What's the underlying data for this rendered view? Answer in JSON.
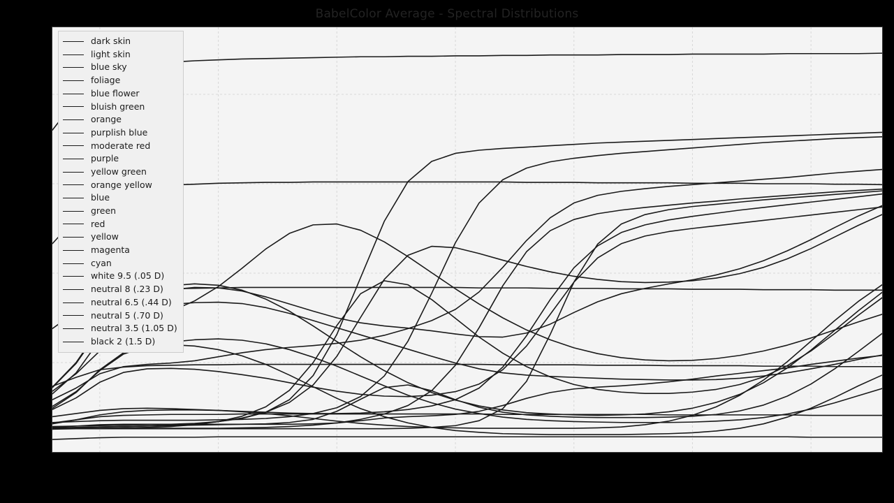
{
  "figure": {
    "background_color": "#000000",
    "plot_background_color": "#f4f4f4",
    "title": "BabelColor Average - Spectral Distributions",
    "title_color": "#232323",
    "line_color": "#1a1a1a",
    "grid_color": "#d8d8d8"
  },
  "legend": {
    "location": "upper left",
    "entries": [
      "dark skin",
      "light skin",
      "blue sky",
      "foliage",
      "blue flower",
      "bluish green",
      "orange",
      "purplish blue",
      "moderate red",
      "purple",
      "yellow green",
      "orange yellow",
      "blue",
      "green",
      "red",
      "yellow",
      "magenta",
      "cyan",
      "white 9.5 (.05 D)",
      "neutral 8 (.23 D)",
      "neutral 6.5 (.44 D)",
      "neutral 5 (.70 D)",
      "neutral 3.5 (1.05 D)",
      "black 2 (1.5 D)"
    ]
  },
  "chart_data": {
    "type": "line",
    "title": "BabelColor Average - Spectral Distributions",
    "xlabel": "",
    "ylabel": "",
    "xlim": [
      380,
      730
    ],
    "ylim": [
      0.0,
      0.95
    ],
    "grid": true,
    "legend_position": "upper left",
    "x": [
      380,
      390,
      400,
      410,
      420,
      430,
      440,
      450,
      460,
      470,
      480,
      490,
      500,
      510,
      520,
      530,
      540,
      550,
      560,
      570,
      580,
      590,
      600,
      610,
      620,
      630,
      640,
      650,
      660,
      670,
      680,
      690,
      700,
      710,
      720,
      730
    ],
    "series": [
      {
        "name": "dark skin",
        "values": [
          0.055,
          0.058,
          0.061,
          0.062,
          0.062,
          0.062,
          0.062,
          0.062,
          0.062,
          0.062,
          0.062,
          0.063,
          0.065,
          0.07,
          0.076,
          0.079,
          0.081,
          0.084,
          0.091,
          0.104,
          0.12,
          0.133,
          0.141,
          0.145,
          0.148,
          0.152,
          0.157,
          0.163,
          0.17,
          0.176,
          0.182,
          0.188,
          0.196,
          0.203,
          0.21,
          0.216
        ]
      },
      {
        "name": "light skin",
        "values": [
          0.117,
          0.143,
          0.175,
          0.191,
          0.196,
          0.199,
          0.204,
          0.213,
          0.222,
          0.229,
          0.234,
          0.238,
          0.243,
          0.25,
          0.261,
          0.276,
          0.294,
          0.319,
          0.358,
          0.413,
          0.473,
          0.524,
          0.557,
          0.574,
          0.583,
          0.589,
          0.594,
          0.598,
          0.602,
          0.606,
          0.61,
          0.614,
          0.619,
          0.624,
          0.628,
          0.632
        ]
      },
      {
        "name": "blue sky",
        "values": [
          0.13,
          0.177,
          0.251,
          0.306,
          0.324,
          0.33,
          0.334,
          0.335,
          0.332,
          0.323,
          0.31,
          0.294,
          0.278,
          0.262,
          0.246,
          0.23,
          0.214,
          0.199,
          0.186,
          0.177,
          0.172,
          0.169,
          0.167,
          0.165,
          0.163,
          0.162,
          0.161,
          0.161,
          0.162,
          0.165,
          0.17,
          0.177,
          0.186,
          0.196,
          0.207,
          0.217
        ]
      },
      {
        "name": "foliage",
        "values": [
          0.051,
          0.054,
          0.056,
          0.057,
          0.058,
          0.059,
          0.06,
          0.061,
          0.062,
          0.063,
          0.066,
          0.073,
          0.091,
          0.118,
          0.144,
          0.15,
          0.137,
          0.117,
          0.1,
          0.089,
          0.083,
          0.08,
          0.078,
          0.077,
          0.077,
          0.077,
          0.078,
          0.08,
          0.084,
          0.092,
          0.105,
          0.125,
          0.152,
          0.186,
          0.225,
          0.265
        ]
      },
      {
        "name": "blue flower",
        "values": [
          0.144,
          0.198,
          0.274,
          0.33,
          0.353,
          0.363,
          0.368,
          0.367,
          0.36,
          0.347,
          0.331,
          0.315,
          0.3,
          0.289,
          0.282,
          0.277,
          0.271,
          0.264,
          0.258,
          0.257,
          0.266,
          0.286,
          0.312,
          0.336,
          0.354,
          0.366,
          0.376,
          0.385,
          0.396,
          0.41,
          0.428,
          0.45,
          0.475,
          0.502,
          0.528,
          0.551
        ]
      },
      {
        "name": "bluish green",
        "values": [
          0.136,
          0.175,
          0.226,
          0.27,
          0.296,
          0.315,
          0.338,
          0.37,
          0.411,
          0.454,
          0.489,
          0.508,
          0.51,
          0.496,
          0.47,
          0.437,
          0.401,
          0.365,
          0.331,
          0.3,
          0.273,
          0.251,
          0.233,
          0.22,
          0.211,
          0.206,
          0.204,
          0.205,
          0.209,
          0.216,
          0.226,
          0.239,
          0.255,
          0.273,
          0.291,
          0.308
        ]
      },
      {
        "name": "orange",
        "values": [
          0.054,
          0.054,
          0.053,
          0.053,
          0.053,
          0.053,
          0.053,
          0.053,
          0.054,
          0.055,
          0.057,
          0.06,
          0.065,
          0.073,
          0.085,
          0.104,
          0.137,
          0.194,
          0.278,
          0.372,
          0.448,
          0.495,
          0.52,
          0.533,
          0.541,
          0.547,
          0.552,
          0.557,
          0.561,
          0.566,
          0.57,
          0.574,
          0.578,
          0.582,
          0.585,
          0.588
        ]
      },
      {
        "name": "purplish blue",
        "values": [
          0.145,
          0.2,
          0.277,
          0.335,
          0.361,
          0.372,
          0.376,
          0.373,
          0.362,
          0.342,
          0.315,
          0.282,
          0.247,
          0.213,
          0.182,
          0.155,
          0.133,
          0.116,
          0.103,
          0.094,
          0.088,
          0.085,
          0.083,
          0.082,
          0.083,
          0.085,
          0.09,
          0.098,
          0.111,
          0.129,
          0.155,
          0.188,
          0.228,
          0.272,
          0.316,
          0.357
        ]
      },
      {
        "name": "moderate red",
        "values": [
          0.079,
          0.086,
          0.093,
          0.097,
          0.098,
          0.097,
          0.095,
          0.093,
          0.091,
          0.089,
          0.087,
          0.086,
          0.086,
          0.087,
          0.09,
          0.095,
          0.103,
          0.117,
          0.143,
          0.19,
          0.26,
          0.341,
          0.412,
          0.461,
          0.491,
          0.508,
          0.519,
          0.527,
          0.534,
          0.541,
          0.547,
          0.553,
          0.559,
          0.565,
          0.571,
          0.577
        ]
      },
      {
        "name": "purple",
        "values": [
          0.063,
          0.072,
          0.083,
          0.09,
          0.093,
          0.094,
          0.094,
          0.093,
          0.09,
          0.086,
          0.081,
          0.075,
          0.069,
          0.064,
          0.06,
          0.057,
          0.055,
          0.054,
          0.053,
          0.053,
          0.053,
          0.053,
          0.053,
          0.054,
          0.056,
          0.061,
          0.069,
          0.082,
          0.101,
          0.127,
          0.161,
          0.202,
          0.248,
          0.294,
          0.337,
          0.374
        ]
      },
      {
        "name": "yellow green",
        "values": [
          0.054,
          0.055,
          0.056,
          0.057,
          0.058,
          0.06,
          0.063,
          0.068,
          0.076,
          0.089,
          0.111,
          0.15,
          0.214,
          0.301,
          0.386,
          0.44,
          0.46,
          0.457,
          0.444,
          0.429,
          0.415,
          0.403,
          0.393,
          0.386,
          0.381,
          0.379,
          0.38,
          0.383,
          0.389,
          0.399,
          0.413,
          0.432,
          0.455,
          0.481,
          0.507,
          0.531
        ]
      },
      {
        "name": "orange yellow",
        "values": [
          0.066,
          0.068,
          0.07,
          0.071,
          0.071,
          0.071,
          0.071,
          0.072,
          0.073,
          0.075,
          0.079,
          0.086,
          0.099,
          0.124,
          0.17,
          0.248,
          0.355,
          0.468,
          0.557,
          0.609,
          0.635,
          0.649,
          0.657,
          0.663,
          0.668,
          0.672,
          0.676,
          0.68,
          0.684,
          0.688,
          0.692,
          0.695,
          0.698,
          0.701,
          0.703,
          0.705
        ]
      },
      {
        "name": "blue",
        "values": [
          0.098,
          0.133,
          0.184,
          0.222,
          0.237,
          0.24,
          0.237,
          0.229,
          0.215,
          0.196,
          0.172,
          0.146,
          0.12,
          0.097,
          0.079,
          0.065,
          0.055,
          0.048,
          0.044,
          0.041,
          0.04,
          0.039,
          0.039,
          0.039,
          0.039,
          0.04,
          0.041,
          0.043,
          0.047,
          0.053,
          0.063,
          0.078,
          0.098,
          0.122,
          0.148,
          0.172
        ]
      },
      {
        "name": "green",
        "values": [
          0.051,
          0.052,
          0.053,
          0.054,
          0.055,
          0.057,
          0.061,
          0.068,
          0.08,
          0.101,
          0.138,
          0.2,
          0.283,
          0.354,
          0.383,
          0.374,
          0.341,
          0.299,
          0.257,
          0.221,
          0.191,
          0.168,
          0.151,
          0.14,
          0.134,
          0.131,
          0.131,
          0.134,
          0.14,
          0.151,
          0.168,
          0.193,
          0.226,
          0.265,
          0.306,
          0.345
        ]
      },
      {
        "name": "red",
        "values": [
          0.052,
          0.052,
          0.052,
          0.052,
          0.052,
          0.052,
          0.052,
          0.052,
          0.052,
          0.052,
          0.052,
          0.052,
          0.052,
          0.052,
          0.052,
          0.053,
          0.055,
          0.059,
          0.07,
          0.097,
          0.158,
          0.263,
          0.38,
          0.465,
          0.51,
          0.531,
          0.542,
          0.549,
          0.554,
          0.559,
          0.564,
          0.568,
          0.572,
          0.576,
          0.58,
          0.584
        ]
      },
      {
        "name": "yellow",
        "values": [
          0.057,
          0.058,
          0.059,
          0.06,
          0.061,
          0.062,
          0.064,
          0.068,
          0.075,
          0.089,
          0.117,
          0.171,
          0.263,
          0.39,
          0.516,
          0.605,
          0.65,
          0.668,
          0.675,
          0.679,
          0.682,
          0.685,
          0.688,
          0.691,
          0.693,
          0.695,
          0.697,
          0.699,
          0.701,
          0.703,
          0.705,
          0.707,
          0.709,
          0.711,
          0.713,
          0.715
        ]
      },
      {
        "name": "magenta",
        "values": [
          0.095,
          0.121,
          0.156,
          0.178,
          0.186,
          0.187,
          0.185,
          0.18,
          0.173,
          0.165,
          0.155,
          0.145,
          0.136,
          0.129,
          0.125,
          0.124,
          0.127,
          0.135,
          0.152,
          0.184,
          0.237,
          0.308,
          0.38,
          0.434,
          0.466,
          0.483,
          0.493,
          0.5,
          0.506,
          0.512,
          0.518,
          0.524,
          0.53,
          0.536,
          0.542,
          0.548
        ]
      },
      {
        "name": "cyan",
        "values": [
          0.102,
          0.135,
          0.182,
          0.219,
          0.237,
          0.246,
          0.251,
          0.253,
          0.25,
          0.242,
          0.229,
          0.212,
          0.192,
          0.17,
          0.148,
          0.127,
          0.11,
          0.096,
          0.086,
          0.078,
          0.073,
          0.07,
          0.068,
          0.067,
          0.066,
          0.066,
          0.066,
          0.067,
          0.069,
          0.072,
          0.077,
          0.085,
          0.096,
          0.11,
          0.126,
          0.142
        ]
      },
      {
        "name": "white 9.5 (.05 D)",
        "values": [
          0.72,
          0.788,
          0.838,
          0.86,
          0.868,
          0.872,
          0.875,
          0.877,
          0.879,
          0.88,
          0.881,
          0.882,
          0.883,
          0.884,
          0.884,
          0.885,
          0.885,
          0.886,
          0.886,
          0.887,
          0.887,
          0.888,
          0.888,
          0.888,
          0.889,
          0.889,
          0.889,
          0.89,
          0.89,
          0.89,
          0.89,
          0.891,
          0.891,
          0.891,
          0.891,
          0.892
        ]
      },
      {
        "name": "neutral 8 (.23 D)",
        "values": [
          0.466,
          0.524,
          0.57,
          0.588,
          0.594,
          0.597,
          0.599,
          0.601,
          0.602,
          0.603,
          0.603,
          0.604,
          0.604,
          0.604,
          0.604,
          0.604,
          0.604,
          0.604,
          0.604,
          0.604,
          0.603,
          0.603,
          0.603,
          0.602,
          0.602,
          0.602,
          0.602,
          0.601,
          0.601,
          0.601,
          0.6,
          0.6,
          0.6,
          0.599,
          0.599,
          0.598
        ]
      },
      {
        "name": "neutral 6.5 (.44 D)",
        "values": [
          0.276,
          0.314,
          0.346,
          0.358,
          0.363,
          0.365,
          0.366,
          0.367,
          0.368,
          0.368,
          0.368,
          0.368,
          0.368,
          0.368,
          0.368,
          0.368,
          0.368,
          0.368,
          0.367,
          0.367,
          0.367,
          0.366,
          0.366,
          0.366,
          0.365,
          0.365,
          0.365,
          0.364,
          0.364,
          0.364,
          0.363,
          0.363,
          0.363,
          0.362,
          0.362,
          0.362
        ]
      },
      {
        "name": "neutral 5 (.70 D)",
        "values": [
          0.147,
          0.167,
          0.184,
          0.19,
          0.193,
          0.194,
          0.195,
          0.195,
          0.196,
          0.196,
          0.196,
          0.196,
          0.196,
          0.196,
          0.196,
          0.196,
          0.196,
          0.196,
          0.196,
          0.195,
          0.195,
          0.195,
          0.195,
          0.194,
          0.194,
          0.194,
          0.193,
          0.193,
          0.193,
          0.193,
          0.192,
          0.192,
          0.192,
          0.191,
          0.191,
          0.191
        ]
      },
      {
        "name": "neutral 3.5 (1.05 D)",
        "values": [
          0.065,
          0.072,
          0.079,
          0.082,
          0.083,
          0.084,
          0.084,
          0.084,
          0.085,
          0.085,
          0.085,
          0.085,
          0.085,
          0.085,
          0.085,
          0.085,
          0.085,
          0.085,
          0.085,
          0.084,
          0.084,
          0.084,
          0.084,
          0.084,
          0.084,
          0.084,
          0.083,
          0.083,
          0.083,
          0.083,
          0.083,
          0.083,
          0.082,
          0.082,
          0.082,
          0.082
        ]
      },
      {
        "name": "black 2 (1.5 D)",
        "values": [
          0.028,
          0.03,
          0.032,
          0.033,
          0.033,
          0.033,
          0.033,
          0.034,
          0.034,
          0.034,
          0.034,
          0.034,
          0.034,
          0.034,
          0.034,
          0.034,
          0.034,
          0.034,
          0.034,
          0.034,
          0.034,
          0.034,
          0.034,
          0.034,
          0.034,
          0.034,
          0.034,
          0.034,
          0.034,
          0.034,
          0.034,
          0.034,
          0.033,
          0.033,
          0.033,
          0.033
        ]
      }
    ]
  }
}
